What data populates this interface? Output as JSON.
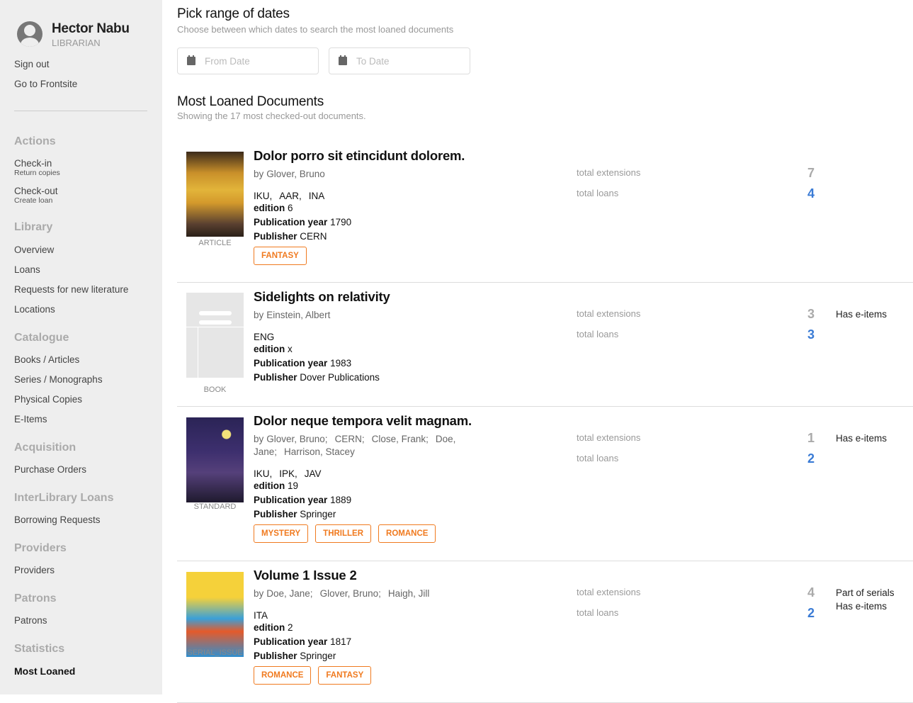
{
  "user": {
    "name": "Hector Nabu",
    "role": "LIBRARIAN",
    "sign_out": "Sign out",
    "frontsite": "Go to Frontsite"
  },
  "sidebar": {
    "actions": {
      "title": "Actions",
      "checkin": "Check-in",
      "checkin_sub": "Return copies",
      "checkout": "Check-out",
      "checkout_sub": "Create loan"
    },
    "library": {
      "title": "Library",
      "items": [
        "Overview",
        "Loans",
        "Requests for new literature",
        "Locations"
      ]
    },
    "catalogue": {
      "title": "Catalogue",
      "items": [
        "Books / Articles",
        "Series / Monographs",
        "Physical Copies",
        "E-Items"
      ]
    },
    "acquisition": {
      "title": "Acquisition",
      "items": [
        "Purchase Orders"
      ]
    },
    "ill": {
      "title": "InterLibrary Loans",
      "items": [
        "Borrowing Requests"
      ]
    },
    "providers": {
      "title": "Providers",
      "items": [
        "Providers"
      ]
    },
    "patrons": {
      "title": "Patrons",
      "items": [
        "Patrons"
      ]
    },
    "statistics": {
      "title": "Statistics",
      "items": [
        "Most Loaned"
      ]
    }
  },
  "range": {
    "title": "Pick range of dates",
    "subtitle": "Choose between which dates to search the most loaned documents",
    "from_placeholder": "From Date",
    "to_placeholder": "To Date"
  },
  "list": {
    "title": "Most Loaned Documents",
    "subtitle": "Showing the 17 most checked-out documents.",
    "ext_label": "total extensions",
    "loans_label": "total loans",
    "edition_label": "edition",
    "pubyear_label": "Publication year",
    "publisher_label": "Publisher",
    "items": [
      {
        "title": "Dolor porro sit etincidunt dolorem.",
        "by": "by",
        "authors": [
          "Glover, Bruno"
        ],
        "type": "ARTICLE",
        "languages": [
          "IKU,",
          "AAR,",
          "INA"
        ],
        "edition": "6",
        "year": "1790",
        "publisher": "CERN",
        "tags": [
          "FANTASY"
        ],
        "extensions": "7",
        "loans": "4",
        "extras": []
      },
      {
        "title": "Sidelights on relativity",
        "by": "by",
        "authors": [
          "Einstein, Albert"
        ],
        "type": "BOOK",
        "languages": [
          "ENG"
        ],
        "edition": "x",
        "year": "1983",
        "publisher": "Dover Publications",
        "tags": [],
        "extensions": "3",
        "loans": "3",
        "extras": [
          "Has e-items"
        ]
      },
      {
        "title": "Dolor neque tempora velit magnam.",
        "by": "by",
        "authors": [
          "Glover, Bruno;",
          "CERN;",
          "Close, Frank;",
          "Doe, Jane;",
          "Harrison, Stacey"
        ],
        "type": "STANDARD",
        "languages": [
          "IKU,",
          "IPK,",
          "JAV"
        ],
        "edition": "19",
        "year": "1889",
        "publisher": "Springer",
        "tags": [
          "MYSTERY",
          "THRILLER",
          "ROMANCE"
        ],
        "extensions": "1",
        "loans": "2",
        "extras": [
          "Has e-items"
        ]
      },
      {
        "title": "Volume 1 Issue 2",
        "by": "by",
        "authors": [
          "Doe, Jane;",
          "Glover, Bruno;",
          "Haigh, Jill"
        ],
        "type": "SERIAL_ISSUE",
        "languages": [
          "ITA"
        ],
        "edition": "2",
        "year": "1817",
        "publisher": "Springer",
        "tags": [
          "ROMANCE",
          "FANTASY"
        ],
        "extensions": "4",
        "loans": "2",
        "extras": [
          "Part of serials",
          "Has e-items"
        ]
      }
    ]
  }
}
